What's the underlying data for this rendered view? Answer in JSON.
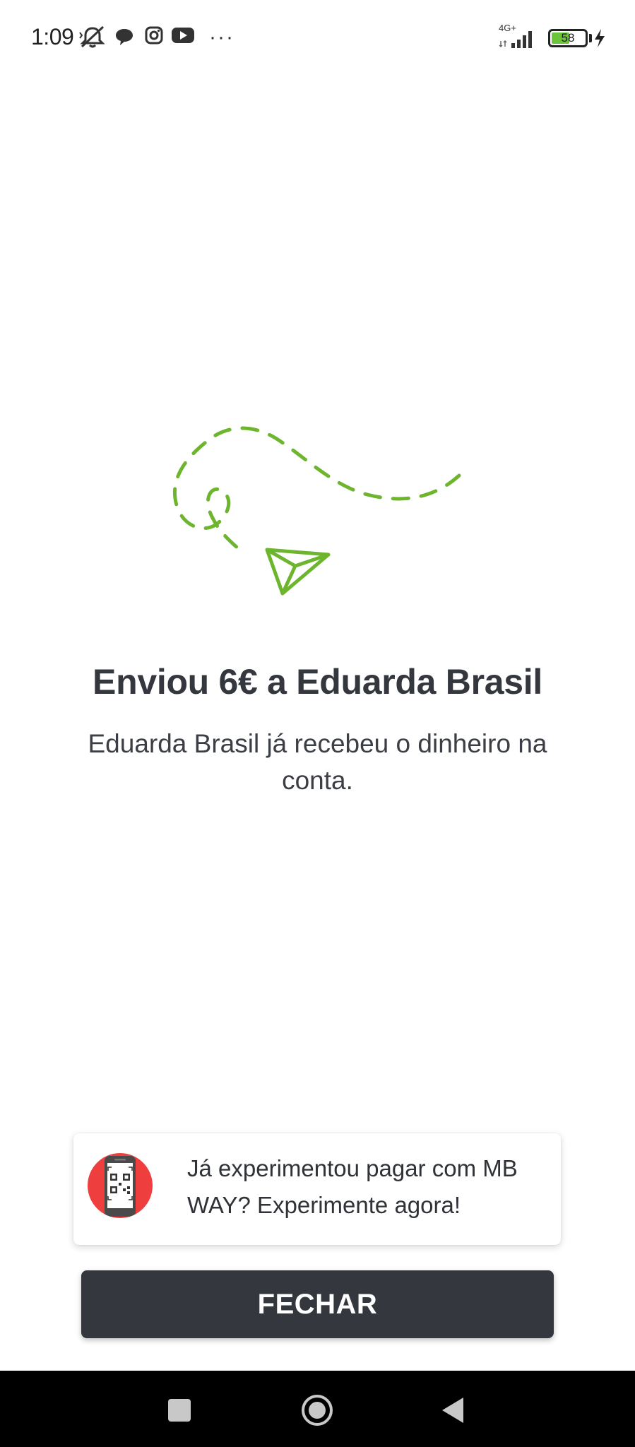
{
  "status_bar": {
    "time": "1:09",
    "network": "4G+",
    "battery": "58",
    "battery_level": 0.58,
    "icons": [
      "mute-icon",
      "message-icon",
      "instagram-icon",
      "youtube-icon",
      "more-icon",
      "signal-icon",
      "battery-icon",
      "charging-icon"
    ],
    "more": "···"
  },
  "illustration": {
    "icon": "paper-plane-dashed-path-icon",
    "color": "#6cb52d"
  },
  "main": {
    "title": "Enviou 6€ a Eduarda Brasil",
    "subtitle": "Eduarda Brasil  já recebeu o dinheiro na conta."
  },
  "promo": {
    "icon": "qr-phone-icon",
    "text": "Já experimentou pagar com MB WAY? Experimente agora!"
  },
  "actions": {
    "close_label": "FECHAR"
  },
  "nav": {
    "icons": [
      "recents-icon",
      "home-icon",
      "back-icon"
    ]
  },
  "colors": {
    "accent": "#6cb52d",
    "button": "#34373d",
    "promo_icon_bg": "#ef3e3e"
  }
}
